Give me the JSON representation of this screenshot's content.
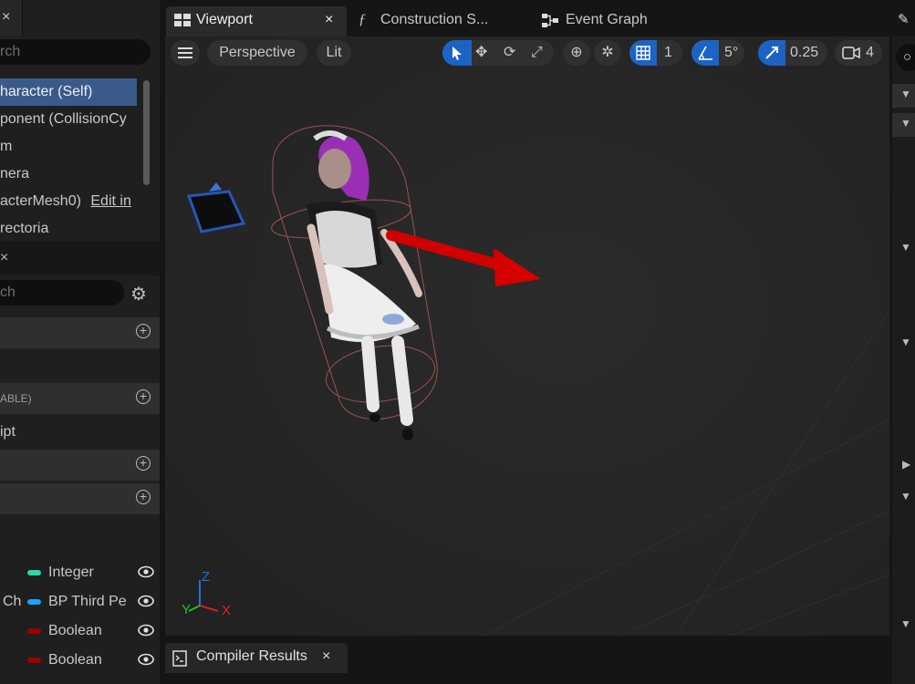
{
  "components": {
    "search_placeholder": "rch",
    "items": [
      {
        "label": "haracter (Self)"
      },
      {
        "label": "ponent (CollisionCy"
      },
      {
        "label": "m"
      },
      {
        "label": "nera"
      },
      {
        "label": "acterMesh0)",
        "extra": "Edit in"
      },
      {
        "label": "rectoria"
      }
    ]
  },
  "details": {
    "close": "×",
    "search_placeholder": "ch",
    "section_label": "ABLE)",
    "script_label": "ipt",
    "variables": [
      {
        "name": "Integer",
        "color": "#27d9a8",
        "prefix": ""
      },
      {
        "name": "BP Third Pe",
        "color": "#1aa3ff",
        "prefix": "Ch"
      },
      {
        "name": "Boolean",
        "color": "#9d0000",
        "prefix": ""
      },
      {
        "name": "Boolean",
        "color": "#9d0000",
        "prefix": ""
      }
    ]
  },
  "tabs": [
    {
      "label": "Viewport",
      "close": "×"
    },
    {
      "label": "Construction S..."
    },
    {
      "label": "Event Graph"
    }
  ],
  "viewport_toolbar": {
    "perspective": "Perspective",
    "lit": "Lit",
    "grid_value": "1",
    "angle_value": "5°",
    "scale_value": "0.25",
    "camera_speed": "4"
  },
  "axes": {
    "z": "Z",
    "y": "Y",
    "x": "X"
  },
  "bottom": {
    "compiler_results": "Compiler Results",
    "close": "×"
  }
}
